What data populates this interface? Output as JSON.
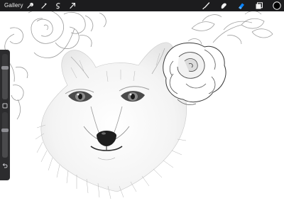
{
  "toolbar": {
    "gallery_label": "Gallery",
    "left_tools": [
      {
        "icon": "wrench-icon"
      },
      {
        "icon": "adjustments-wand-icon"
      },
      {
        "icon": "selection-icon"
      },
      {
        "icon": "transform-arrow-icon"
      }
    ],
    "right_tools": [
      {
        "icon": "brush-icon"
      },
      {
        "icon": "smudge-icon"
      },
      {
        "icon": "eraser-icon"
      },
      {
        "icon": "layers-icon"
      },
      {
        "icon": "color-swatch-icon"
      }
    ],
    "active_tool": "eraser-icon",
    "active_color": "#0a84ff",
    "current_color": "#000000"
  },
  "sidebar": {
    "brush_size_level": 0.72,
    "opacity_level": 0.62,
    "modify_button_icon": "modify-square-icon",
    "undo_icon": "undo-arrow-icon"
  },
  "canvas": {
    "subject": "fox-and-roses-sketch"
  }
}
